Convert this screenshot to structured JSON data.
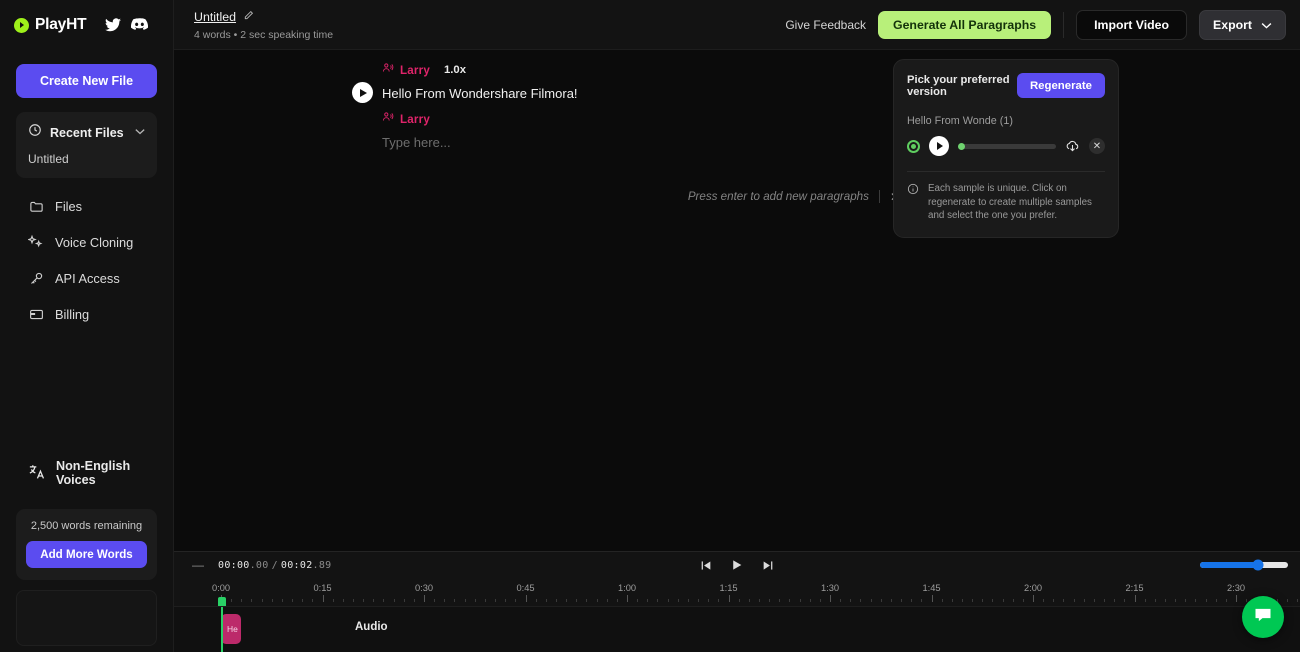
{
  "brand": {
    "name": "PlayHT",
    "logo_icon": "play-circle-icon",
    "twitter_icon": "twitter-icon",
    "discord_icon": "discord-icon"
  },
  "sidebar": {
    "create_button": "Create New File",
    "recent": {
      "label": "Recent Files",
      "icon": "clock-icon",
      "chevron": "chevron-down-icon",
      "items": [
        "Untitled"
      ]
    },
    "nav": [
      {
        "label": "Files",
        "icon": "folder-icon"
      },
      {
        "label": "Voice Cloning",
        "icon": "sparkles-icon"
      },
      {
        "label": "API Access",
        "icon": "key-icon"
      },
      {
        "label": "Billing",
        "icon": "credit-card-icon"
      }
    ],
    "non_english": {
      "label": "Non-English Voices",
      "icon": "translate-icon"
    },
    "words": {
      "remaining": "2,500 words remaining",
      "add_button": "Add More Words"
    }
  },
  "topbar": {
    "doc_title": "Untitled",
    "edit_icon": "pencil-edit-icon",
    "doc_subtitle": "4 words • 2 sec speaking time",
    "feedback_link": "Give Feedback",
    "generate_button": "Generate All Paragraphs",
    "import_button": "Import Video",
    "export_button": "Export",
    "export_chevron": "chevron-down-icon"
  },
  "editor": {
    "paragraphs": [
      {
        "voice": "Larry",
        "voice_icon": "speaker-person-icon",
        "speed": "1.0x",
        "text": "Hello From Wondershare Filmora!",
        "is_placeholder": false,
        "has_play": true
      },
      {
        "voice": "Larry",
        "voice_icon": "speaker-person-icon",
        "speed": "",
        "text": "Type here...",
        "is_placeholder": true,
        "has_play": false
      }
    ],
    "hint": "Press enter to add new paragraphs",
    "hint_close_icon": "close-icon"
  },
  "version_panel": {
    "title": "Pick your preferred version",
    "regenerate_button": "Regenerate",
    "sample_name": "Hello From Wonde (1)",
    "radio_icon": "radio-selected-icon",
    "play_icon": "play-icon",
    "download_icon": "download-cloud-icon",
    "close_icon": "close-icon",
    "info_icon": "info-circle-icon",
    "info_text": "Each sample is unique. Click on regenerate to create multiple samples and select the one you prefer."
  },
  "timeline": {
    "minimize_icon": "minimize-icon",
    "current_time": "00:00",
    "current_ms": ".00",
    "total_time": "00:02",
    "total_ms": ".89",
    "transport": [
      {
        "name": "skip-to-start-button",
        "icon": "skip-back-icon"
      },
      {
        "name": "play-button",
        "icon": "play-icon"
      },
      {
        "name": "skip-to-end-button",
        "icon": "skip-forward-icon"
      }
    ],
    "zoom_value": 66,
    "zoom_color": "#1673e8",
    "ruler_labels": [
      "0:00",
      "0:15",
      "0:30",
      "0:45",
      "1:00",
      "1:15",
      "1:30",
      "1:45",
      "2:00",
      "2:15",
      "2:30"
    ],
    "track_label": "Audio",
    "clip": {
      "label": "He",
      "color": "#bc2a6a"
    },
    "playhead_color": "#29d166"
  },
  "chat_fab": {
    "icon": "chat-bubble-icon",
    "color": "#00c853"
  }
}
